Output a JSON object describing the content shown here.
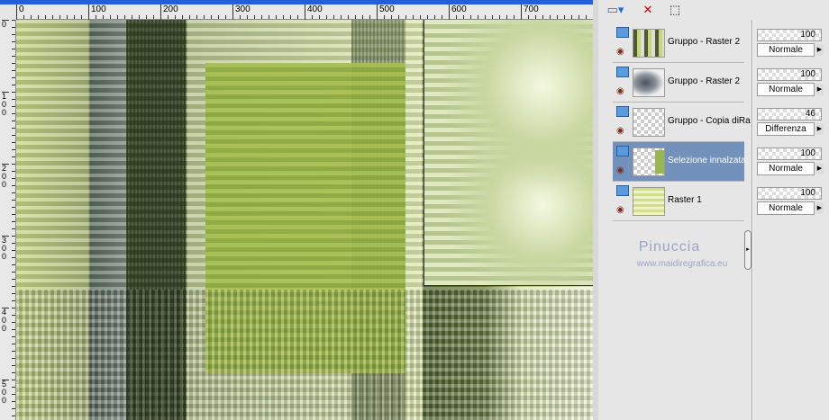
{
  "rulers": {
    "horizontal": [
      "0",
      "100",
      "200",
      "300",
      "400",
      "500",
      "600",
      "700"
    ],
    "vertical": [
      "0",
      "100",
      "200",
      "300",
      "400",
      "500"
    ]
  },
  "toolbar": {
    "icons": [
      "new-layer-icon",
      "delete-layer-icon",
      "mask-brush-icon"
    ]
  },
  "layers": [
    {
      "name": "Gruppo - Raster 2",
      "opacity": "100",
      "blend": "Normale",
      "selected": false
    },
    {
      "name": "Gruppo - Raster 2",
      "opacity": "100",
      "blend": "Normale",
      "selected": false
    },
    {
      "name": "Gruppo - Copia diRa",
      "opacity": "46",
      "blend": "Differenza",
      "selected": false
    },
    {
      "name": "Selezione innalzata",
      "opacity": "100",
      "blend": "Normale",
      "selected": true
    },
    {
      "name": "Raster 1",
      "opacity": "100",
      "blend": "Normale",
      "selected": false
    }
  ],
  "watermark": {
    "name": "Pinuccia",
    "url": "www.maidiregrafica.eu"
  },
  "colors": {
    "selection": "#7291bb",
    "title_bar": "#2a5bd8"
  }
}
